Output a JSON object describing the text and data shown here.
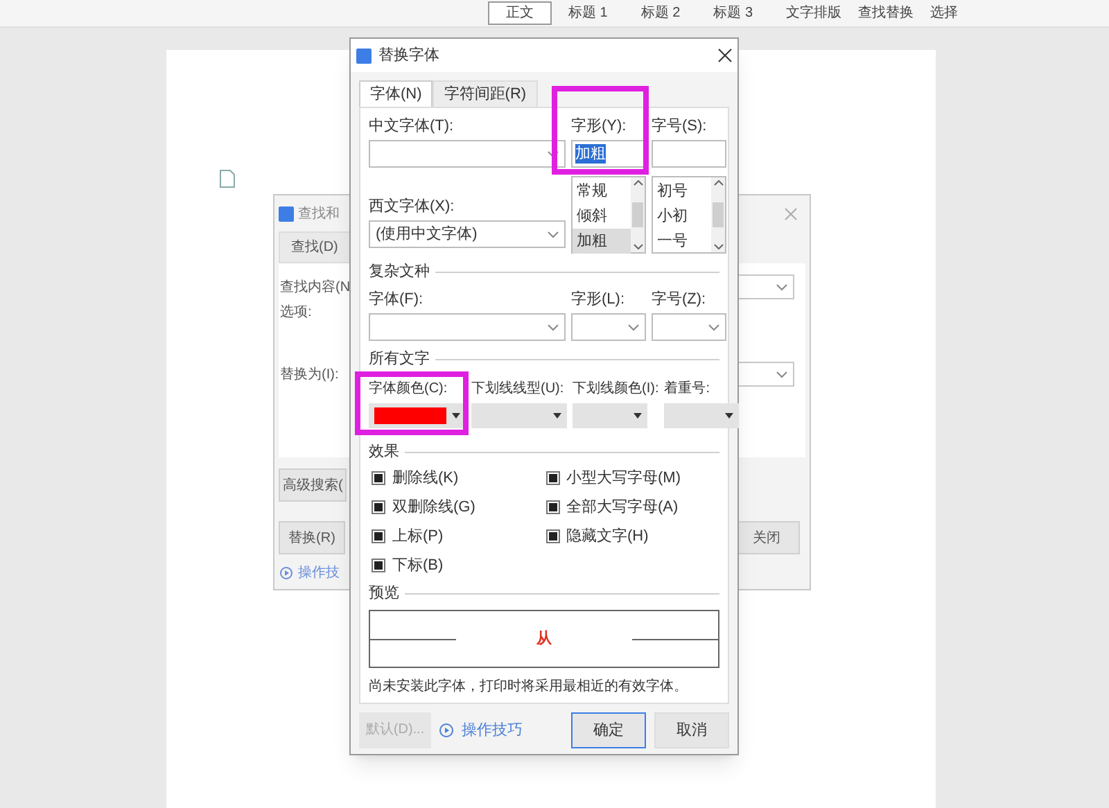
{
  "toolbar": {
    "styles": [
      {
        "label": "正文",
        "selected": true
      },
      {
        "label": "标题 1",
        "selected": false
      },
      {
        "label": "标题 2",
        "selected": false
      },
      {
        "label": "标题 3",
        "selected": false
      }
    ],
    "commands": [
      "文字排版",
      "查找替换",
      "选择"
    ]
  },
  "find_dialog": {
    "title": "查找和",
    "tabs": [
      {
        "label": "查找(D)",
        "selected": true
      }
    ],
    "labels": [
      "查找内容(N",
      "选项:",
      "替换为(I):"
    ],
    "advanced_button": "高级搜索(",
    "replace_button": "替换(R)",
    "tips_link": "操作技",
    "close_button": "关闭"
  },
  "font_dialog": {
    "title": "替换字体",
    "tabs": [
      {
        "label": "字体(N)",
        "selected": true
      },
      {
        "label": "字符间距(R)",
        "selected": false
      }
    ],
    "chinese_font": {
      "label": "中文字体(T):"
    },
    "style": {
      "label": "字形(Y):",
      "value": "加粗",
      "options": [
        {
          "label": "常规",
          "selected": false
        },
        {
          "label": "倾斜",
          "selected": false
        },
        {
          "label": "加粗",
          "selected": true
        }
      ]
    },
    "size": {
      "label": "字号(S):",
      "options": [
        {
          "label": "初号",
          "selected": false
        },
        {
          "label": "小初",
          "selected": false
        },
        {
          "label": "一号",
          "selected": false
        }
      ]
    },
    "western_font": {
      "label": "西文字体(X):",
      "value": "(使用中文字体)"
    },
    "complex": {
      "title": "复杂文种",
      "fields": [
        {
          "label": "字体(F):"
        },
        {
          "label": "字形(L):"
        },
        {
          "label": "字号(Z):"
        }
      ]
    },
    "all_text": {
      "title": "所有文字",
      "fields": [
        {
          "label": "字体颜色(C):",
          "color": "#ff0000"
        },
        {
          "label": "下划线线型(U):"
        },
        {
          "label": "下划线颜色(I):"
        },
        {
          "label": "着重号:"
        }
      ]
    },
    "effects": {
      "title": "效果",
      "items": [
        {
          "label": "删除线(K)",
          "indeterminate": true
        },
        {
          "label": "小型大写字母(M)",
          "indeterminate": true
        },
        {
          "label": "双删除线(G)",
          "indeterminate": true
        },
        {
          "label": "全部大写字母(A)",
          "indeterminate": true
        },
        {
          "label": "上标(P)",
          "indeterminate": true
        },
        {
          "label": "隐藏文字(H)",
          "indeterminate": true
        },
        {
          "label": "下标(B)",
          "indeterminate": true
        }
      ]
    },
    "preview": {
      "title": "预览",
      "sample": "从",
      "color": "#e03020"
    },
    "note": "尚未安装此字体，打印时将采用最相近的有效字体。",
    "default_button": {
      "label": "默认(D)...",
      "disabled": true
    },
    "tips_link": "操作技巧",
    "ok_button": "确定",
    "cancel_button": "取消"
  }
}
